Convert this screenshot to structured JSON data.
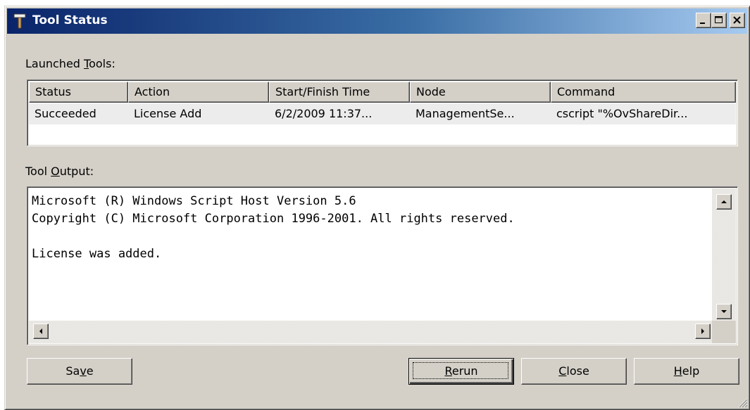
{
  "window": {
    "title": "Tool Status",
    "title_icon": "hammer-icon",
    "controls": [
      "minimize-icon",
      "maximize-icon",
      "close-icon"
    ]
  },
  "launched_tools": {
    "label_pre": "Launched ",
    "label_mnemonic": "T",
    "label_post": "ools:",
    "columns": [
      "Status",
      "Action",
      "Start/Finish Time",
      "Node",
      "Command"
    ],
    "rows": [
      {
        "status": "Succeeded",
        "action": "License Add",
        "time": "6/2/2009 11:37...",
        "node": "ManagementSe...",
        "command": "cscript \"%OvShareDir..."
      }
    ]
  },
  "tool_output": {
    "label_pre": "Tool ",
    "label_mnemonic": "O",
    "label_post": "utput:",
    "lines": [
      "Microsoft (R) Windows Script Host Version 5.6",
      "Copyright (C) Microsoft Corporation 1996-2001. All rights reserved.",
      "",
      "License was added."
    ]
  },
  "buttons": {
    "save": {
      "pre": "Sa",
      "mnemonic": "v",
      "post": "e"
    },
    "rerun": {
      "pre": "",
      "mnemonic": "R",
      "post": "erun"
    },
    "close": {
      "pre": "",
      "mnemonic": "C",
      "post": "lose"
    },
    "help": {
      "pre": "",
      "mnemonic": "H",
      "post": "elp"
    }
  },
  "colors": {
    "title_gradient_start": "#0a246a",
    "title_gradient_end": "#a6caf0",
    "face": "#d4d0c8",
    "selected_row": "#ececec"
  }
}
